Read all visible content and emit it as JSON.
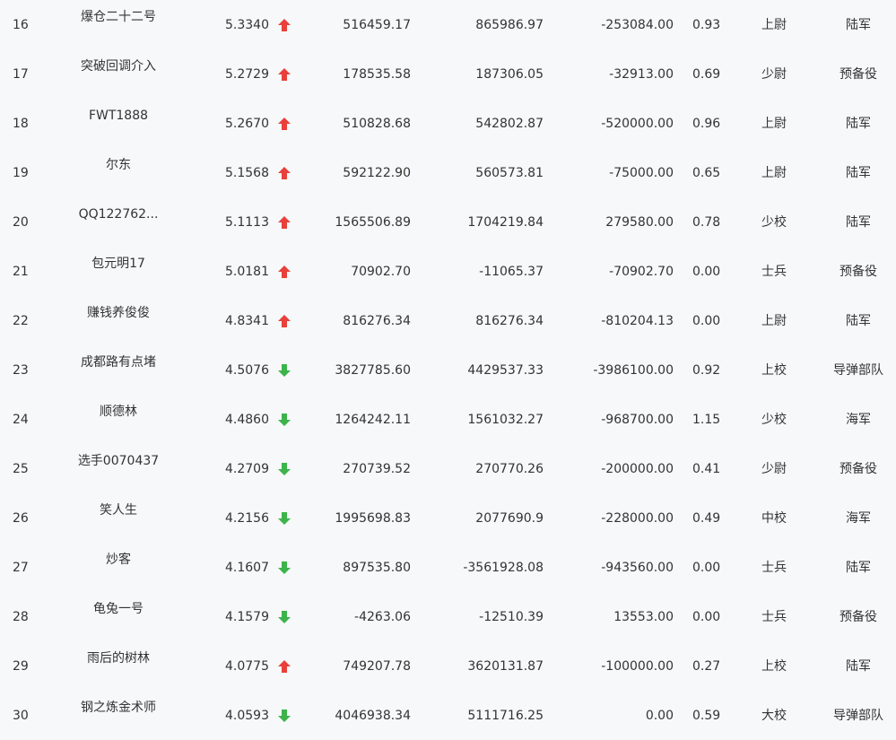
{
  "colors": {
    "up": "#e8403b",
    "down": "#3cb44b",
    "text": "#333333",
    "background": "#f7f8fa"
  },
  "rows": [
    {
      "rank": "16",
      "name": "爆仓二十二号",
      "score": "5.3340",
      "trend": "up",
      "v1": "516459.17",
      "v2": "865986.97",
      "v3": "-253084.00",
      "ratio": "0.93",
      "title": "上尉",
      "branch": "陆军"
    },
    {
      "rank": "17",
      "name": "突破回调介入",
      "score": "5.2729",
      "trend": "up",
      "v1": "178535.58",
      "v2": "187306.05",
      "v3": "-32913.00",
      "ratio": "0.69",
      "title": "少尉",
      "branch": "预备役"
    },
    {
      "rank": "18",
      "name": "FWT1888",
      "score": "5.2670",
      "trend": "up",
      "v1": "510828.68",
      "v2": "542802.87",
      "v3": "-520000.00",
      "ratio": "0.96",
      "title": "上尉",
      "branch": "陆军"
    },
    {
      "rank": "19",
      "name": "尔东",
      "score": "5.1568",
      "trend": "up",
      "v1": "592122.90",
      "v2": "560573.81",
      "v3": "-75000.00",
      "ratio": "0.65",
      "title": "上尉",
      "branch": "陆军"
    },
    {
      "rank": "20",
      "name": "QQ122762...",
      "score": "5.1113",
      "trend": "up",
      "v1": "1565506.89",
      "v2": "1704219.84",
      "v3": "279580.00",
      "ratio": "0.78",
      "title": "少校",
      "branch": "陆军"
    },
    {
      "rank": "21",
      "name": "包元明17",
      "score": "5.0181",
      "trend": "up",
      "v1": "70902.70",
      "v2": "-11065.37",
      "v3": "-70902.70",
      "ratio": "0.00",
      "title": "士兵",
      "branch": "预备役"
    },
    {
      "rank": "22",
      "name": "赚钱养俊俊",
      "score": "4.8341",
      "trend": "up",
      "v1": "816276.34",
      "v2": "816276.34",
      "v3": "-810204.13",
      "ratio": "0.00",
      "title": "上尉",
      "branch": "陆军"
    },
    {
      "rank": "23",
      "name": "成都路有点堵",
      "score": "4.5076",
      "trend": "down",
      "v1": "3827785.60",
      "v2": "4429537.33",
      "v3": "-3986100.00",
      "ratio": "0.92",
      "title": "上校",
      "branch": "导弹部队"
    },
    {
      "rank": "24",
      "name": "顺德林",
      "score": "4.4860",
      "trend": "down",
      "v1": "1264242.11",
      "v2": "1561032.27",
      "v3": "-968700.00",
      "ratio": "1.15",
      "title": "少校",
      "branch": "海军"
    },
    {
      "rank": "25",
      "name": "选手0070437",
      "score": "4.2709",
      "trend": "down",
      "v1": "270739.52",
      "v2": "270770.26",
      "v3": "-200000.00",
      "ratio": "0.41",
      "title": "少尉",
      "branch": "预备役"
    },
    {
      "rank": "26",
      "name": "笑人生",
      "score": "4.2156",
      "trend": "down",
      "v1": "1995698.83",
      "v2": "2077690.9",
      "v3": "-228000.00",
      "ratio": "0.49",
      "title": "中校",
      "branch": "海军"
    },
    {
      "rank": "27",
      "name": "炒客",
      "score": "4.1607",
      "trend": "down",
      "v1": "897535.80",
      "v2": "-3561928.08",
      "v3": "-943560.00",
      "ratio": "0.00",
      "title": "士兵",
      "branch": "陆军"
    },
    {
      "rank": "28",
      "name": "龟兔一号",
      "score": "4.1579",
      "trend": "down",
      "v1": "-4263.06",
      "v2": "-12510.39",
      "v3": "13553.00",
      "ratio": "0.00",
      "title": "士兵",
      "branch": "预备役"
    },
    {
      "rank": "29",
      "name": "雨后的树林",
      "score": "4.0775",
      "trend": "up",
      "v1": "749207.78",
      "v2": "3620131.87",
      "v3": "-100000.00",
      "ratio": "0.27",
      "title": "上校",
      "branch": "陆军"
    },
    {
      "rank": "30",
      "name": "钢之炼金术师",
      "score": "4.0593",
      "trend": "down",
      "v1": "4046938.34",
      "v2": "5111716.25",
      "v3": "0.00",
      "ratio": "0.59",
      "title": "大校",
      "branch": "导弹部队"
    }
  ]
}
